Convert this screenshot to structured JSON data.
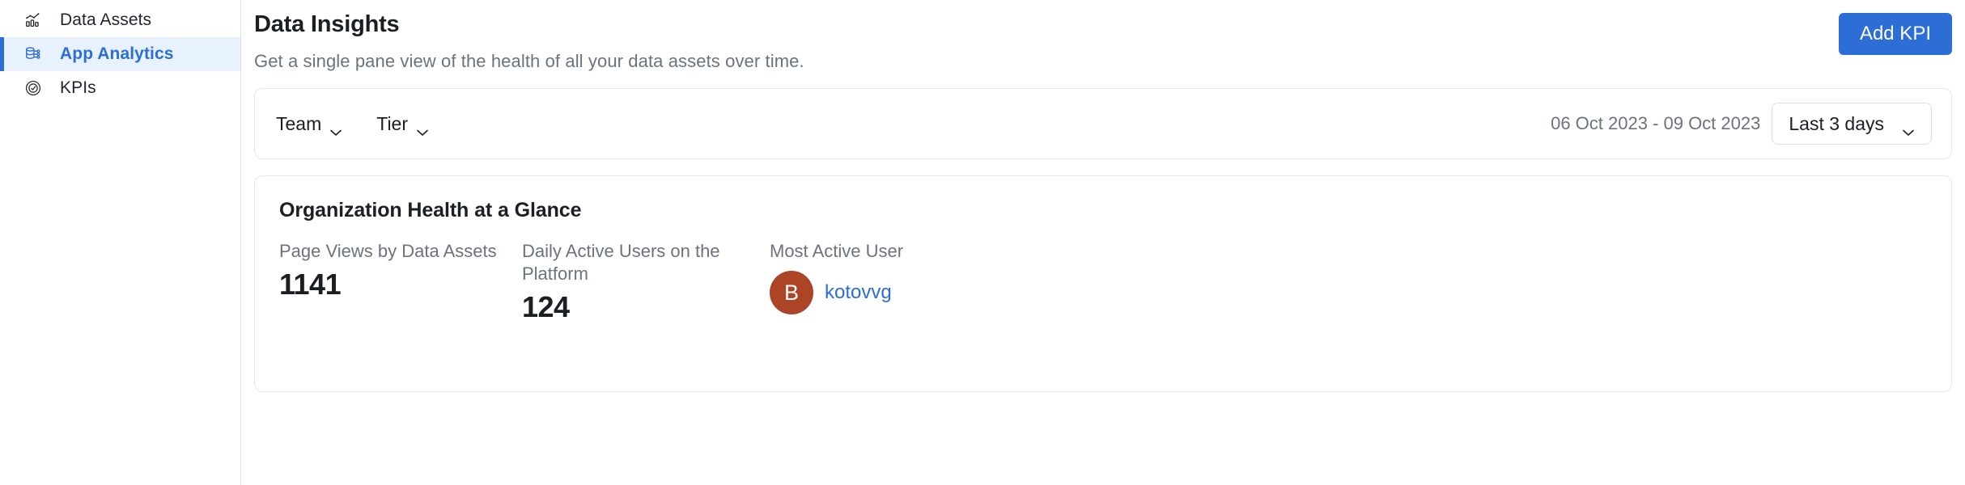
{
  "sidebar": {
    "items": [
      {
        "label": "Data Assets",
        "icon": "chart-bars-icon",
        "active": false
      },
      {
        "label": "App Analytics",
        "icon": "database-network-icon",
        "active": true
      },
      {
        "label": "KPIs",
        "icon": "target-check-icon",
        "active": false
      }
    ]
  },
  "header": {
    "title": "Data Insights",
    "subtitle": "Get a single pane view of the health of all your data assets over time.",
    "add_kpi_label": "Add KPI"
  },
  "filters": {
    "team_label": "Team",
    "tier_label": "Tier",
    "date_range": "06 Oct 2023 - 09 Oct 2023",
    "range_selected": "Last 3 days"
  },
  "glance": {
    "title": "Organization Health at a Glance",
    "metrics": [
      {
        "label": "Page Views by Data Assets",
        "value": "1141"
      },
      {
        "label": "Daily Active Users on the Platform",
        "value": "124"
      }
    ],
    "most_active_user": {
      "label": "Most Active User",
      "avatar_initial": "B",
      "avatar_color": "#ac4425",
      "username": "kotovvg"
    }
  },
  "colors": {
    "accent": "#2c6ed5",
    "active_nav_bg": "#e8f2fe",
    "muted_text": "#6b7280",
    "card_border": "#e4e7ec"
  }
}
